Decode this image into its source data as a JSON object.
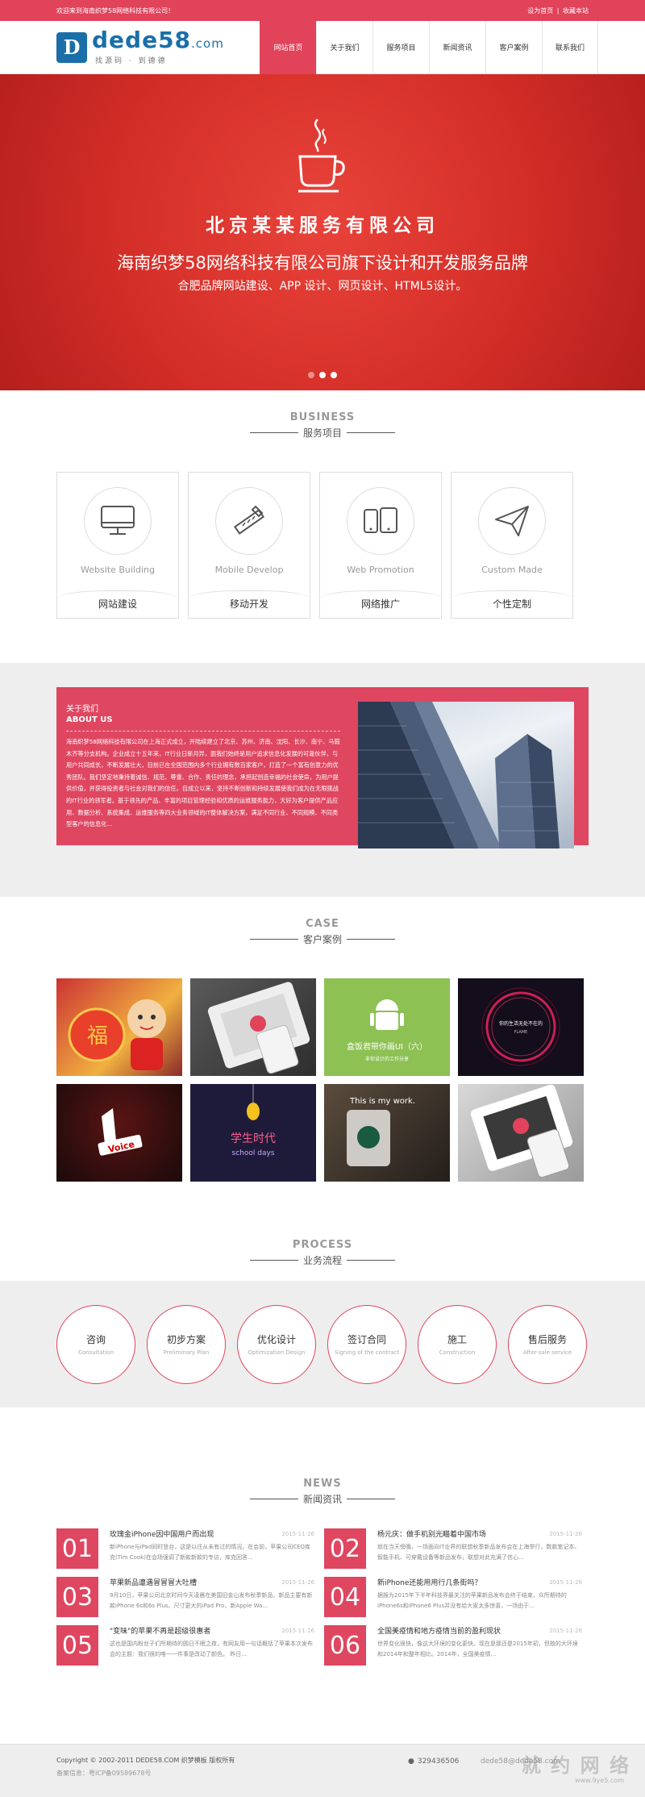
{
  "topbar": {
    "welcome": "欢迎来到海南织梦58网络科技有限公司！",
    "set_home": "设为首页",
    "sep": "|",
    "bookmark": "收藏本站"
  },
  "logo": {
    "letter": "D",
    "name": "dede58",
    "suffix": ".com",
    "tagline": "找源码 · 到德德"
  },
  "nav": [
    "网站首页",
    "关于我们",
    "服务项目",
    "新闻资讯",
    "客户案例",
    "联系我们"
  ],
  "banner": {
    "company": "北京某某服务有限公司",
    "slogan": "海南织梦58网络科技有限公司旗下设计和开发服务品牌",
    "slogan2": "合肥品牌网站建设、APP 设计、网页设计、HTML5设计。"
  },
  "business": {
    "title_en": "BUSINESS",
    "title_cn": "服务项目",
    "items": [
      {
        "en": "Website Building",
        "cn": "网站建设",
        "icon": "monitor-icon"
      },
      {
        "en": "Mobile Develop",
        "cn": "移动开发",
        "icon": "ruler-pencil-icon"
      },
      {
        "en": "Web Promotion",
        "cn": "网络推广",
        "icon": "devices-icon"
      },
      {
        "en": "Custom Made",
        "cn": "个性定制",
        "icon": "paper-plane-icon"
      }
    ]
  },
  "about": {
    "title_cn": "关于我们",
    "title_en": "ABOUT US",
    "body": "海南织梦58网络科技有限公司在上海正式成立，并陆续建立了北京、苏州、济南、沈阳、长沙、南宁、马鞍木齐等分支机构。企业成立十五年来，IT行业日新月异，面我们始终是用户追求信息化发展的可靠伙伴，与用户共同成长，不断发展壮大，目前已在全国范围内多个行业拥有数百家客户，打造了一个富有创意力的优秀团队。我们坚定地秉持着诚信、规范、尊重、合作、责任的理念，承担起创造幸福的社会使命，为用户提供价值，并获得投资者与社会对我们的信任。自成立以来，坚持不断创新和持续发展使我们成为在无限挑战的IT行业的领军者。基于领先的产品、丰富的项目管理经验和优质的运维服务能力，天好为客户提供产品应用、数据分析、系统集成、运维服务等四大业务领域的IT整体解决方案，满足不同行业、不同规模、不同类型客户的信息化..."
  },
  "case": {
    "title_en": "CASE",
    "title_cn": "客户案例",
    "green_title": "盒饭君带你画UI（六）",
    "green_sub": "非你设计的工作分享",
    "poster_text": "学生时代",
    "poster_sub": "school days",
    "coffee_text": "This is my work.",
    "voice_text": "Voice",
    "dark_text": "你的生活无处不在的",
    "dark_sub": "FLAME"
  },
  "process": {
    "title_en": "PROCESS",
    "title_cn": "业务流程",
    "steps": [
      {
        "cn": "咨询",
        "en": "Consultation"
      },
      {
        "cn": "初步方案",
        "en": "Preliminary Plan"
      },
      {
        "cn": "优化设计",
        "en": "Optimization Design"
      },
      {
        "cn": "签订合同",
        "en": "Signing of the contract"
      },
      {
        "cn": "施工",
        "en": "Construction"
      },
      {
        "cn": "售后服务",
        "en": "After-sale service"
      }
    ]
  },
  "news": {
    "title_en": "NEWS",
    "title_cn": "新闻资讯",
    "items": [
      {
        "num": "01",
        "title": "玫瑰金iPhone因中国用户而出现",
        "date": "2015-11-26",
        "desc": "新iPhone与iPad同时登台，这是以往从未有过的情况。在会前，苹果公司CEO库克(Tim Cook)在会场强调了新款新款的专访，库克回答..."
      },
      {
        "num": "02",
        "title": "杨元庆：做手机别光瞄着中国市场",
        "date": "2015-11-26",
        "desc": "就在当天傍晚，一场面向IT业界的联想秋季新品发布会在上海举行，数款笔记本、智能手机、可穿戴设备等新品发布，联想对此充满了信心..."
      },
      {
        "num": "03",
        "title": "苹果新品遭遇冒冒冒大吐槽",
        "date": "2015-11-26",
        "desc": "9月10日，苹果公司北京时间今天凌晨在美国旧金山发布秋季新品，新品主要有新款iPhone 6s和6s Plus、尺寸更大的iPad Pro、新Apple Wa..."
      },
      {
        "num": "04",
        "title": "新iPhone还能用用行几条街吗？",
        "date": "2015-11-26",
        "desc": "据报为2015年下半年科技界最关注的苹果新品发布会终于结束，众所期待的iPhone6s和iPhone6 Plus并没有给大家太多惊喜，一场由于..."
      },
      {
        "num": "05",
        "title": "\"变味\"的苹果不再是超级很惠者",
        "date": "2015-11-26",
        "desc": "这也是国内粉丝子们所期待的圆日不眠之夜，有网友用一句话概括了苹果本次发布会的主题：我们很的唯一一件事是改动了颜色。 昨日..."
      },
      {
        "num": "06",
        "title": "全国美疫情和地方疫情当前的盈利现状",
        "date": "2015-11-26",
        "desc": "世界变化很快，像这大环境的变化更快。现在是那还是2015年初，但故的大环境和2014年和整年相比。2014年，全国美疫情..."
      }
    ]
  },
  "footer": {
    "copyright": "Copyright © 2002-2011 DEDE58.COM 织梦模板 版权所有",
    "icp": "备案信息：粤ICP备09589678号",
    "qq": "329436506",
    "email": "dede58@dede58.com",
    "watermark": "就 约 网 络",
    "watermark_url": "www.9ye5.com"
  },
  "colors": {
    "accent": "#e0435a",
    "banner": "#d42e28",
    "logo": "#1a6fa8"
  }
}
